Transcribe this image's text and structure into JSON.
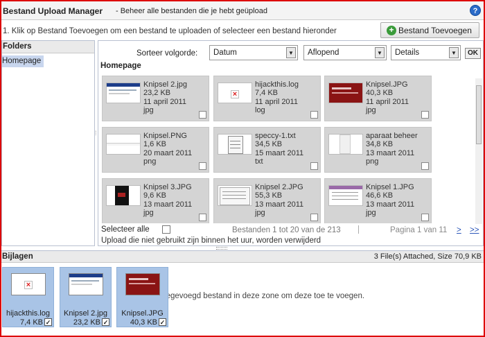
{
  "header": {
    "title": "Bestand Upload Manager",
    "subtitle": "- Beheer alle bestanden die je hebt geüpload",
    "help_icon": "?"
  },
  "instructions": {
    "text": "1. Klik op Bestand Toevoegen om een bestand te uploaden of selecteer een bestand hieronder",
    "add_button": "Bestand Toevoegen",
    "add_icon": "plus-circle-icon"
  },
  "folders": {
    "title": "Folders",
    "items": [
      {
        "label": "Homepage",
        "selected": true
      }
    ]
  },
  "toolbar": {
    "sort_label": "Sorteer volgorde:",
    "sort_field": "Datum",
    "sort_direction": "Aflopend",
    "view_mode": "Details",
    "ok_label": "OK"
  },
  "section_title": "Homepage",
  "files": [
    {
      "name": "Knipsel 2.jpg",
      "size": "23,2 KB",
      "date": "11 april 2011",
      "type": "jpg",
      "thumb": "screenshot"
    },
    {
      "name": "hijackthis.log",
      "size": "7,4 KB",
      "date": "11 april 2011",
      "type": "log",
      "thumb": "broken"
    },
    {
      "name": "Knipsel.JPG",
      "size": "40,3 KB",
      "date": "11 april 2011",
      "type": "jpg",
      "thumb": "red"
    },
    {
      "name": "Knipsel.PNG",
      "size": "1,6 KB",
      "date": "20 maart 2011",
      "type": "png",
      "thumb": "bar"
    },
    {
      "name": "speccy-1.txt",
      "size": "34,5 KB",
      "date": "15 maart 2011",
      "type": "txt",
      "thumb": "notepad"
    },
    {
      "name": "aparaat beheer",
      "size": "34,8 KB",
      "date": "13 maart 2011",
      "type": "png",
      "thumb": "tall"
    },
    {
      "name": "Knipsel 3.JPG",
      "size": "9,6 KB",
      "date": "13 maart 2011",
      "type": "jpg",
      "thumb": "dark"
    },
    {
      "name": "Knipsel 2.JPG",
      "size": "55,3 KB",
      "date": "13 maart 2011",
      "type": "jpg",
      "thumb": "doc"
    },
    {
      "name": "Knipsel 1.JPG",
      "size": "46,6 KB",
      "date": "13 maart 2011",
      "type": "jpg",
      "thumb": "doc2"
    }
  ],
  "footer": {
    "select_all": "Selecteer alle",
    "range": "Bestanden 1 tot 20 van de 213",
    "page_info": "Pagina 1 van 11",
    "next": ">",
    "last": ">>",
    "notice": "Upload die niet gebruikt zijn binnen het uur, worden verwijderd"
  },
  "attachments": {
    "title": "Bijlagen",
    "summary": "3 File(s) Attached, Size 70,9 KB",
    "drop_text": "toegevoegd bestand in deze zone om deze toe te voegen.",
    "items": [
      {
        "name": "hijackthis.log",
        "size": "7,4 KB",
        "checked": true,
        "thumb": "broken"
      },
      {
        "name": "Knipsel 2.jpg",
        "size": "23,2 KB",
        "checked": true,
        "thumb": "screenshot"
      },
      {
        "name": "Knipsel.JPG",
        "size": "40,3 KB",
        "checked": true,
        "thumb": "red"
      }
    ]
  }
}
